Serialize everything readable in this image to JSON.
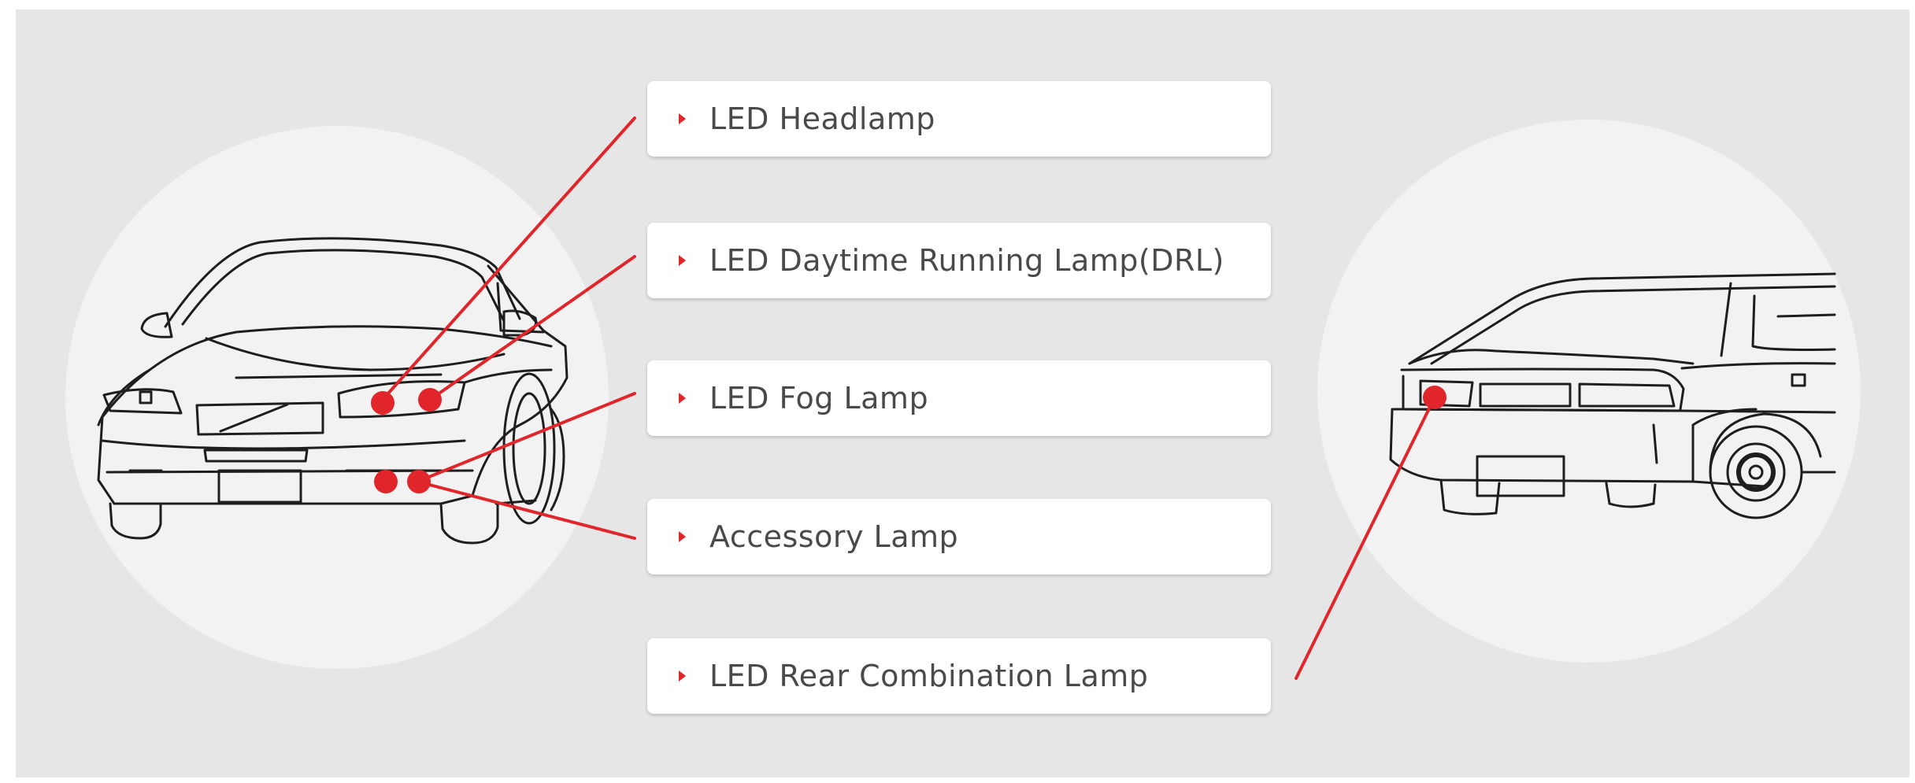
{
  "colors": {
    "background": "#e6e6e6",
    "circle": "#f2f2f2",
    "accent": "#e1262b",
    "outline": "#1e1e1e",
    "label_text": "#4a4a4a"
  },
  "labels": [
    "LED Headlamp",
    "LED Daytime Running Lamp(DRL)",
    "LED Fog Lamp",
    "Accessory Lamp",
    "LED Rear Combination Lamp"
  ]
}
